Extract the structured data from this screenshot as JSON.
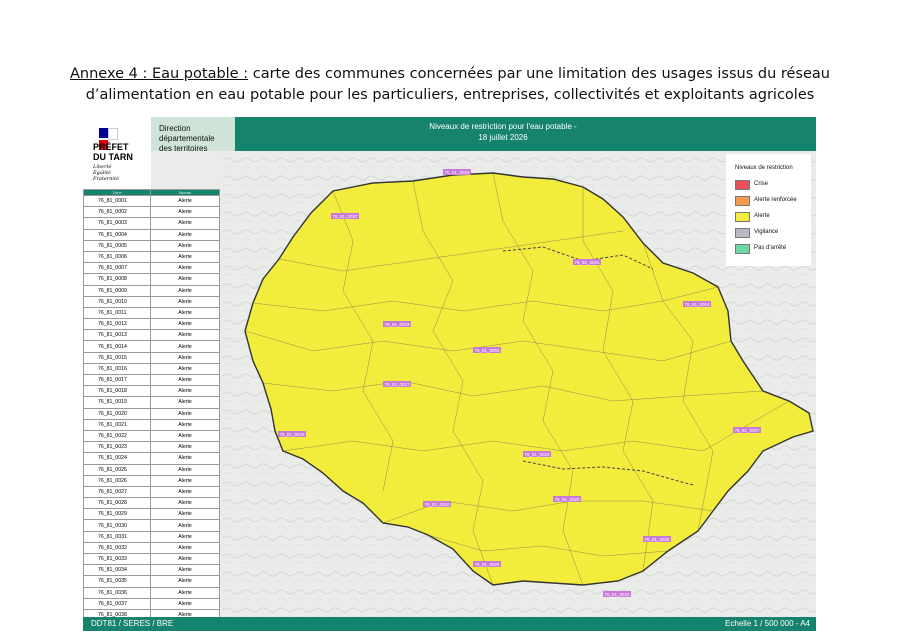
{
  "heading": {
    "lead": "Annexe 4 : Eau potable :",
    "line1": " carte des communes concernées par une limitation des usages issus du réseau",
    "line2": "d’alimentation en eau potable pour les particuliers, entreprises, collectivités et exploitants agricoles"
  },
  "brand": {
    "prefet_name": "PRÉFET\nDU TARN",
    "motto": "Liberté\nÉgalité\nFraternité",
    "flag_colors": [
      "#000091",
      "#ffffff",
      "#e1000f"
    ]
  },
  "ddt_label": "Direction  départementale\ndes territoires",
  "header_title": {
    "line1": "Niveaux de restriction pour l'eau potable -",
    "line2": "18 juillet 2026"
  },
  "legend": {
    "title": "Niveaux de restriction",
    "items": [
      {
        "label": "Crise",
        "color": "#e8505b"
      },
      {
        "label": "Alerte renforcée",
        "color": "#f39a4c"
      },
      {
        "label": "Alerte",
        "color": "#f2ec3d"
      },
      {
        "label": "Vigilance",
        "color": "#b8b8c0"
      },
      {
        "label": "Pas d'arrêté",
        "color": "#6fd7a6"
      }
    ]
  },
  "table": {
    "headers": [
      "Zone",
      "Niveau"
    ],
    "rows": [
      {
        "zone": "76_81_0001",
        "level": "Alerte"
      },
      {
        "zone": "76_81_0002",
        "level": "Alerte"
      },
      {
        "zone": "76_81_0003",
        "level": "Alerte"
      },
      {
        "zone": "76_81_0004",
        "level": "Alerte"
      },
      {
        "zone": "76_81_0005",
        "level": "Alerte"
      },
      {
        "zone": "76_81_0006",
        "level": "Alerte"
      },
      {
        "zone": "76_81_0007",
        "level": "Alerte"
      },
      {
        "zone": "76_81_0008",
        "level": "Alerte"
      },
      {
        "zone": "76_81_0009",
        "level": "Alerte"
      },
      {
        "zone": "76_81_0010",
        "level": "Alerte"
      },
      {
        "zone": "76_81_0011",
        "level": "Alerte"
      },
      {
        "zone": "76_81_0012",
        "level": "Alerte"
      },
      {
        "zone": "76_81_0013",
        "level": "Alerte"
      },
      {
        "zone": "76_81_0014",
        "level": "Alerte"
      },
      {
        "zone": "76_81_0015",
        "level": "Alerte"
      },
      {
        "zone": "76_81_0016",
        "level": "Alerte"
      },
      {
        "zone": "76_81_0017",
        "level": "Alerte"
      },
      {
        "zone": "76_81_0018",
        "level": "Alerte"
      },
      {
        "zone": "76_81_0019",
        "level": "Alerte"
      },
      {
        "zone": "76_81_0020",
        "level": "Alerte"
      },
      {
        "zone": "76_81_0021",
        "level": "Alerte"
      },
      {
        "zone": "76_81_0022",
        "level": "Alerte"
      },
      {
        "zone": "76_81_0023",
        "level": "Alerte"
      },
      {
        "zone": "76_81_0024",
        "level": "Alerte"
      },
      {
        "zone": "76_81_0025",
        "level": "Alerte"
      },
      {
        "zone": "76_81_0026",
        "level": "Alerte"
      },
      {
        "zone": "76_81_0027",
        "level": "Alerte"
      },
      {
        "zone": "76_81_0028",
        "level": "Alerte"
      },
      {
        "zone": "76_81_0029",
        "level": "Alerte"
      },
      {
        "zone": "76_81_0030",
        "level": "Alerte"
      },
      {
        "zone": "76_81_0031",
        "level": "Alerte"
      },
      {
        "zone": "76_81_0032",
        "level": "Alerte"
      },
      {
        "zone": "76_81_0033",
        "level": "Alerte"
      },
      {
        "zone": "76_81_0034",
        "level": "Alerte"
      },
      {
        "zone": "76_81_0035",
        "level": "Alerte"
      },
      {
        "zone": "76_81_0036",
        "level": "Alerte"
      },
      {
        "zone": "76_81_0037",
        "level": "Alerte"
      },
      {
        "zone": "76_81_0038",
        "level": "Alerte"
      }
    ]
  },
  "map": {
    "fill_color": "#f2ec3d",
    "tag_color": "#c77ad9",
    "zone_tags": [
      "76_81_0034",
      "76_81_0037",
      "76_81_0001",
      "76_81_0004",
      "76_81_0003",
      "76_81_0002",
      "76_81_0007",
      "76_81_0018",
      "76_81_0024",
      "76_81_0010",
      "76_81_0020",
      "76_81_0025",
      "76_81_0022",
      "76_81_0017",
      "76_81_0026"
    ]
  },
  "footer": {
    "left": "DDT81 / SERES / BRE",
    "right": "Echelle 1 / 500 000 - A4"
  }
}
